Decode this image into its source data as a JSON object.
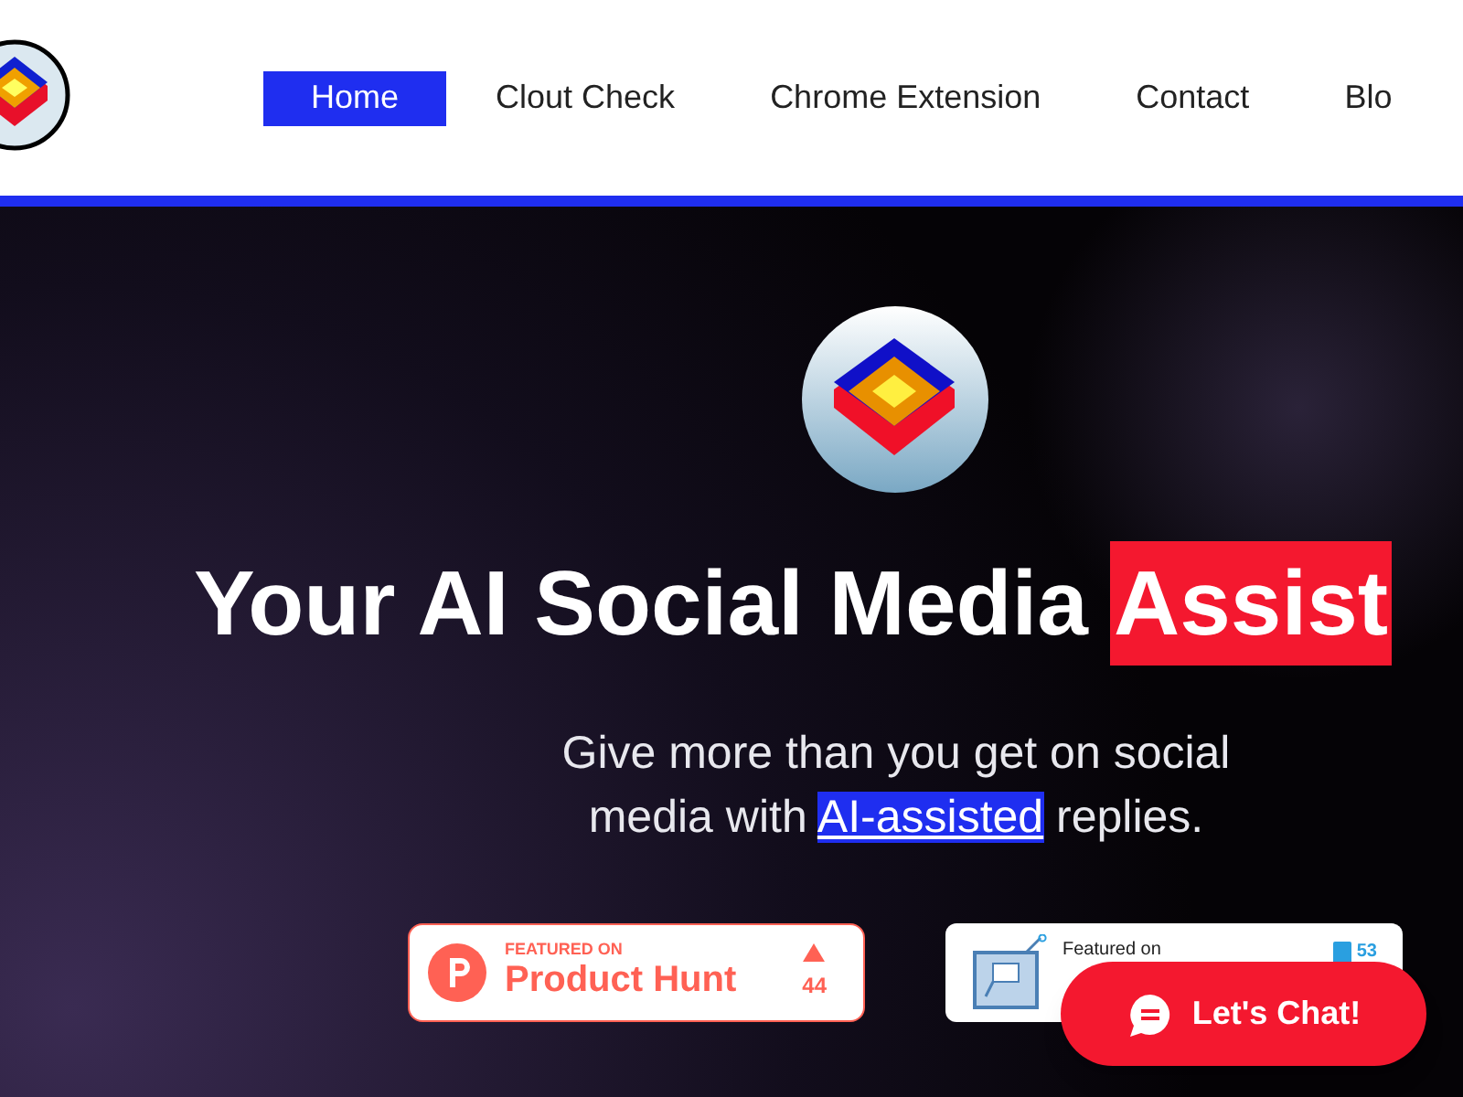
{
  "nav": {
    "items": [
      {
        "label": "Home",
        "selected": true
      },
      {
        "label": "Clout Check",
        "selected": false
      },
      {
        "label": "Chrome Extension",
        "selected": false
      },
      {
        "label": "Contact",
        "selected": false
      },
      {
        "label": "Blo",
        "selected": false
      }
    ]
  },
  "hero": {
    "title": "Your AI Social Media",
    "title_highlight": "Assist",
    "subtitle_before": "Give more than you get on social media with",
    "subtitle_link": "AI-assisted",
    "subtitle_after": "replies."
  },
  "badges": [
    {
      "kind": "producthunt",
      "caption": "FEATURED ON",
      "name": "Product Hunt",
      "count": "44"
    },
    {
      "kind": "featured",
      "caption": "Featured on",
      "count": "53"
    }
  ],
  "chat_button": {
    "label": "Let's Chat!"
  }
}
